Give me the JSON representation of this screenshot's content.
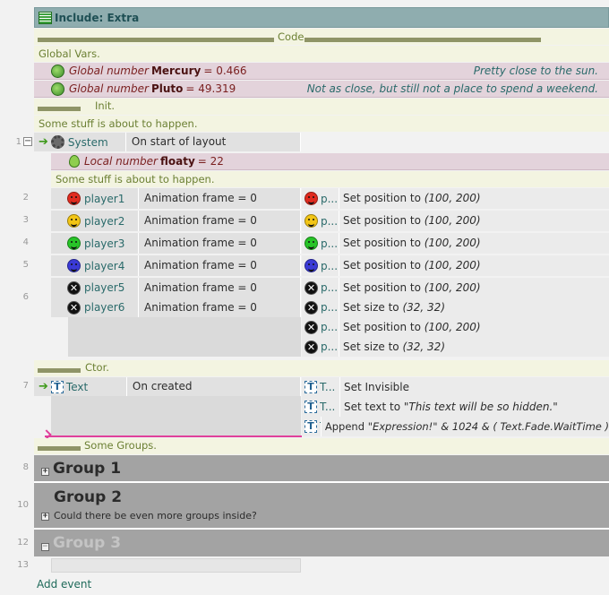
{
  "sheet": {
    "title": "Include: Extra"
  },
  "code_comment": "Code",
  "global_vars_comment": "Global Vars.",
  "globals": [
    {
      "kind": "Global number",
      "name": "Mercury",
      "value": "= 0.466",
      "note": "Pretty close to the sun."
    },
    {
      "kind": "Global number",
      "name": "Pluto",
      "value": "= 49.319",
      "note": "Not as close, but still not a place to spend a weekend."
    }
  ],
  "init_comment": "Init.",
  "stuff_comment_1": "Some stuff is about to happen.",
  "event1": {
    "num": "1",
    "object": "System",
    "condition": "On start of layout"
  },
  "local": {
    "kind": "Local number",
    "name": "floaty",
    "value": "= 22"
  },
  "stuff_comment_2": "Some stuff is about to happen.",
  "players": [
    {
      "num": "2",
      "name": "player1",
      "cond": "Animation frame = 0",
      "act_obj": "p...",
      "act": "Set position to ",
      "args": "(100, 200)",
      "color": "#e02b1f"
    },
    {
      "num": "3",
      "name": "player2",
      "cond": "Animation frame = 0",
      "act_obj": "p...",
      "act": "Set position to ",
      "args": "(100, 200)",
      "color": "#f2c515"
    },
    {
      "num": "4",
      "name": "player3",
      "cond": "Animation frame = 0",
      "act_obj": "p...",
      "act": "Set position to ",
      "args": "(100, 200)",
      "color": "#27c427"
    },
    {
      "num": "5",
      "name": "player4",
      "cond": "Animation frame = 0",
      "act_obj": "p...",
      "act": "Set position to ",
      "args": "(100, 200)",
      "color": "#3a3ad6"
    }
  ],
  "event6": {
    "num": "6",
    "conds": [
      {
        "name": "player5",
        "cond": "Animation frame = 0"
      },
      {
        "name": "player6",
        "cond": "Animation frame = 0"
      }
    ],
    "actions": [
      {
        "obj": "p...",
        "act": "Set position to ",
        "args": "(100, 200)"
      },
      {
        "obj": "p...",
        "act": "Set size to ",
        "args": "(32, 32)"
      },
      {
        "obj": "p...",
        "act": "Set position to ",
        "args": "(100, 200)"
      },
      {
        "obj": "p...",
        "act": "Set size to ",
        "args": "(32, 32)"
      }
    ]
  },
  "ctor_comment": "Ctor.",
  "event7": {
    "num": "7",
    "object": "Text",
    "condition": "On created",
    "actions": [
      {
        "obj": "T...",
        "act": "Set Invisible",
        "args": ""
      },
      {
        "obj": "T...",
        "act": "Set text to ",
        "args": "\"This text will be so hidden.\""
      },
      {
        "obj": "T...",
        "act": "Append ",
        "args": "\"Expression!\" & 1024 & ( Text.Fade.WaitTime )"
      }
    ]
  },
  "groups_comment": "Some Groups.",
  "groups": [
    {
      "num": "8",
      "title": "Group 1",
      "desc": ""
    },
    {
      "num": "10",
      "title": "Group 2",
      "desc": "Could there be even more groups inside?"
    },
    {
      "num": "12",
      "title": "Group 3",
      "desc": ""
    }
  ],
  "event13": {
    "num": "13"
  },
  "add_event": "Add event"
}
